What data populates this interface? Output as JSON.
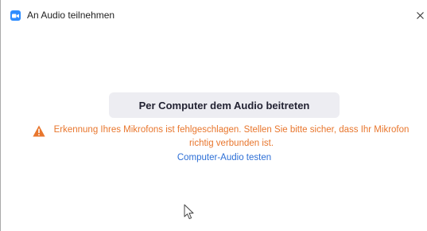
{
  "window": {
    "title": "An Audio teilnehmen",
    "app_icon": "zoom-camera-icon",
    "close_icon": "close-icon"
  },
  "main": {
    "join_button_label": "Per Computer dem Audio beitreten",
    "warning_icon": "warning-triangle-icon",
    "warning_text": "Erkennung Ihres Mikrofons ist fehlgeschlagen. Stellen Sie bitte sicher, dass Ihr Mikrofon richtig verbunden ist.",
    "test_link_label": "Computer-Audio testen"
  },
  "colors": {
    "brand": "#2d8cff",
    "warning": "#e8762d",
    "link": "#2d6fd6",
    "button_bg": "#ededf2"
  }
}
